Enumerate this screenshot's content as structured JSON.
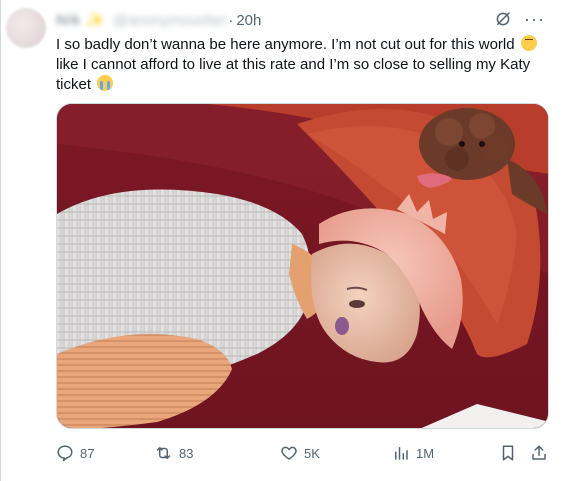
{
  "tweet": {
    "display_name": "Nik ✨",
    "handle": "@anonymousfan",
    "separator": "·",
    "time": "20h",
    "text_parts": {
      "part1": "I so badly don’t wanna be here anymore. I’m not cut out for this world",
      "part2": "like I cannot afford to live at this rate and I’m so close to selling my Katy ticket"
    },
    "emojis": {
      "first": "frowning-face",
      "second": "loudly-crying-face"
    }
  },
  "actions": {
    "replies": "87",
    "reposts": "83",
    "likes": "5K",
    "views": "1M"
  },
  "colors": {
    "text": "#0f1419",
    "muted": "#536471",
    "border": "#cfd9de",
    "background": "#ffffff"
  },
  "icons": {
    "reply": "speech-bubble-icon",
    "repost": "repost-arrows-icon",
    "like": "heart-icon",
    "views": "bar-chart-icon",
    "bookmark": "bookmark-icon",
    "share": "share-upload-icon",
    "grok": "grok-slash-circle-icon",
    "more": "more-dots-icon"
  }
}
